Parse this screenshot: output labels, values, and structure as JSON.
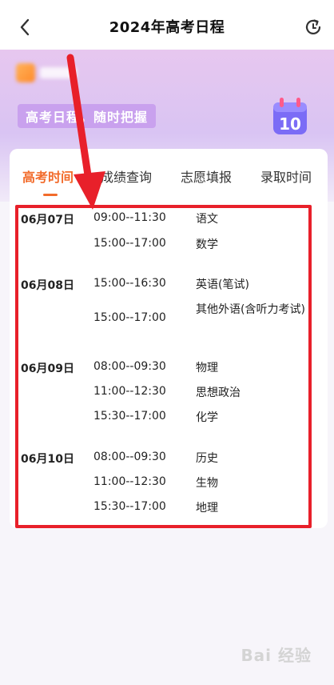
{
  "nav": {
    "title": "2024年高考日程",
    "back_icon": "chevron-left-icon",
    "refresh_icon": "refresh-icon"
  },
  "hero": {
    "slogan": "高考日程，随时把握",
    "calendar_badge": "10",
    "calendar_icon": "calendar-icon"
  },
  "tabs": [
    {
      "label": "高考时间",
      "active": true
    },
    {
      "label": "成绩查询",
      "active": false
    },
    {
      "label": "志愿填报",
      "active": false
    },
    {
      "label": "录取时间",
      "active": false
    }
  ],
  "schedule": [
    {
      "date": "06月07日",
      "time": "09:00--11:30",
      "subject": "语文"
    },
    {
      "date": "",
      "time": "15:00--17:00",
      "subject": "数学"
    },
    {
      "date": "06月08日",
      "time": "15:00--16:30",
      "subject": "英语(笔试)"
    },
    {
      "date": "",
      "time": "15:00--17:00",
      "subject": "其他外语(含听力考试)"
    },
    {
      "date": "06月09日",
      "time": "08:00--09:30",
      "subject": "物理"
    },
    {
      "date": "",
      "time": "11:00--12:30",
      "subject": "思想政治"
    },
    {
      "date": "",
      "time": "15:30--17:00",
      "subject": "化学"
    },
    {
      "date": "06月10日",
      "time": "08:00--09:30",
      "subject": "历史"
    },
    {
      "date": "",
      "time": "11:00--12:30",
      "subject": "生物"
    },
    {
      "date": "",
      "time": "15:30--17:00",
      "subject": "地理"
    }
  ],
  "watermark": "Bai 经验",
  "colors": {
    "accent": "#f26b2b",
    "annotation": "#e8202a",
    "slogan_bg": "#c9a1ee"
  }
}
